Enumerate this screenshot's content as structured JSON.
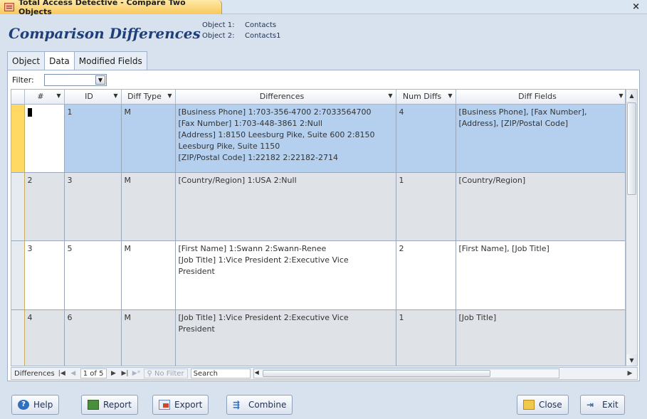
{
  "window": {
    "title": "Total Access Detective - Compare Two Objects",
    "close_glyph": "×"
  },
  "header": {
    "title": "Comparison Differences",
    "object1_label": "Object 1:",
    "object1_value": "Contacts",
    "object2_label": "Object 2:",
    "object2_value": "Contacts1"
  },
  "tabs": {
    "object": "Object",
    "data": "Data",
    "modified_fields": "Modified Fields"
  },
  "filter": {
    "label": "Filter:",
    "value": ""
  },
  "grid": {
    "columns": [
      "#",
      "ID",
      "Diff Type",
      "Differences",
      "Num Diffs",
      "Diff Fields"
    ],
    "rows": [
      {
        "num": "1",
        "id": "1",
        "diff_type": "M",
        "differences": [
          "[Business Phone] 1:703-356-4700 2:7033564700",
          "[Fax Number] 1:703-448-3861 2:Null",
          "[Address] 1:8150 Leesburg Pike, Suite 600 2:8150",
          "Leesburg Pike, Suite 1150",
          "[ZIP/Postal Code] 1:22182 2:22182-2714"
        ],
        "num_diffs": "4",
        "diff_fields": "[Business Phone], [Fax Number], [Address], [ZIP/Postal Code]"
      },
      {
        "num": "2",
        "id": "3",
        "diff_type": "M",
        "differences": [
          "[Country/Region] 1:USA 2:Null"
        ],
        "num_diffs": "1",
        "diff_fields": "[Country/Region]"
      },
      {
        "num": "3",
        "id": "5",
        "diff_type": "M",
        "differences": [
          "[First Name] 1:Swann 2:Swann-Renee",
          "[Job Title] 1:Vice President 2:Executive Vice",
          "President"
        ],
        "num_diffs": "2",
        "diff_fields": "[First Name], [Job Title]"
      },
      {
        "num": "4",
        "id": "6",
        "diff_type": "M",
        "differences": [
          "[Job Title] 1:Vice President 2:Executive Vice",
          "President"
        ],
        "num_diffs": "1",
        "diff_fields": "[Job Title]"
      }
    ]
  },
  "navigation": {
    "label": "Differences",
    "record": "1 of 5",
    "no_filter": "No Filter",
    "search": "Search"
  },
  "buttons": {
    "help": "Help",
    "report": "Report",
    "export": "Export",
    "combine": "Combine",
    "close": "Close",
    "exit": "Exit"
  }
}
